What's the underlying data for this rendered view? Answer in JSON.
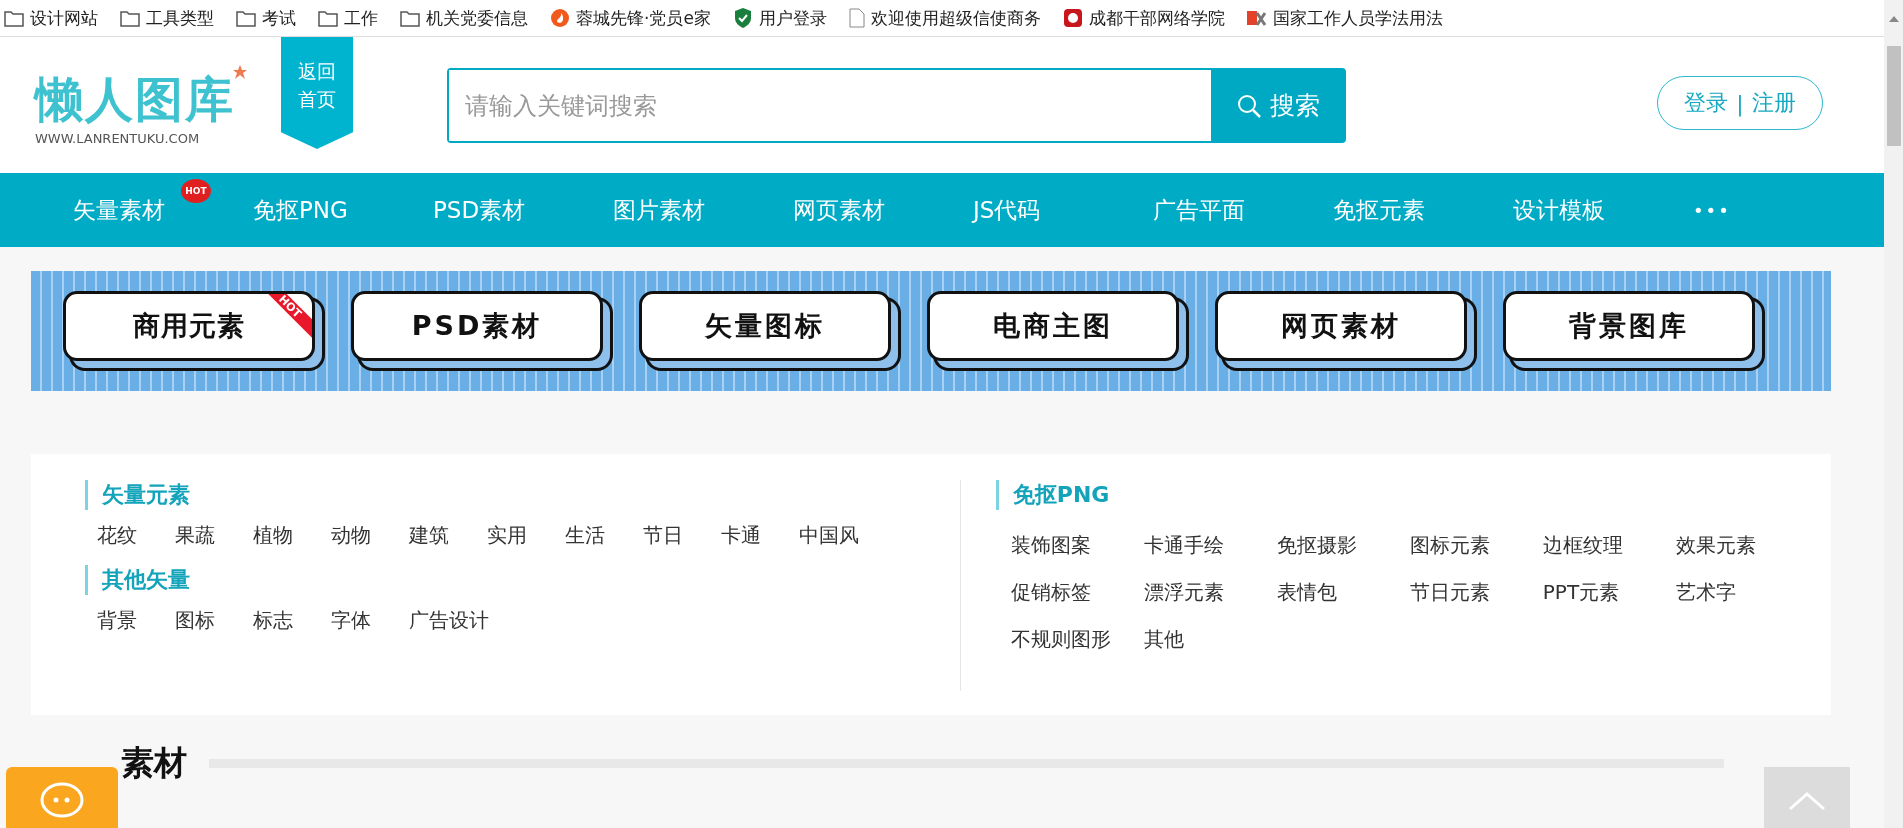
{
  "bookmarks": [
    {
      "label": "设计网站",
      "kind": "folder"
    },
    {
      "label": "工具类型",
      "kind": "folder"
    },
    {
      "label": "考试",
      "kind": "folder"
    },
    {
      "label": "工作",
      "kind": "folder"
    },
    {
      "label": "机关党委信息",
      "kind": "folder"
    },
    {
      "label": "蓉城先锋·党员e家",
      "kind": "flame"
    },
    {
      "label": "用户登录",
      "kind": "shield"
    },
    {
      "label": "欢迎使用超级信使商务",
      "kind": "page"
    },
    {
      "label": "成都干部网络学院",
      "kind": "badge"
    },
    {
      "label": "国家工作人员学法用法",
      "kind": "fx"
    }
  ],
  "header": {
    "logo": "懒人图库",
    "logo_url": "WWW.LANRENTUKU.COM",
    "home_ribbon": [
      "返回",
      "首页"
    ],
    "search": {
      "placeholder": "请输入关键词搜索",
      "button": "搜索"
    },
    "login": "登录",
    "register": "注册",
    "separator": "|"
  },
  "nav": {
    "items": [
      {
        "label": "矢量素材",
        "hot": true,
        "hot_label": "HOT"
      },
      {
        "label": "免抠PNG",
        "hot": false
      },
      {
        "label": "PSD素材",
        "hot": false
      },
      {
        "label": "图片素材",
        "hot": false
      },
      {
        "label": "网页素材",
        "hot": false
      },
      {
        "label": "JS代码",
        "hot": false
      },
      {
        "label": "广告平面",
        "hot": false
      },
      {
        "label": "免抠元素",
        "hot": false
      },
      {
        "label": "设计模板",
        "hot": false
      }
    ],
    "more": "•••"
  },
  "banner": [
    {
      "label": "商用元素",
      "hot": true,
      "hot_label": "HOT"
    },
    {
      "label": "PSD素材",
      "hot": false
    },
    {
      "label": "矢量图标",
      "hot": false
    },
    {
      "label": "电商主图",
      "hot": false
    },
    {
      "label": "网页素材",
      "hot": false
    },
    {
      "label": "背景图库",
      "hot": false
    }
  ],
  "categories": {
    "left": [
      {
        "title": "矢量元素",
        "tags": [
          "花纹",
          "果蔬",
          "植物",
          "动物",
          "建筑",
          "实用",
          "生活",
          "节日",
          "卡通",
          "中国风"
        ]
      },
      {
        "title": "其他矢量",
        "tags": [
          "背景",
          "图标",
          "标志",
          "字体",
          "广告设计"
        ]
      }
    ],
    "right": [
      {
        "title": "免抠PNG",
        "tags": [
          "装饰图案",
          "卡通手绘",
          "免抠摄影",
          "图标元素",
          "边框纹理",
          "效果元素",
          "促销标签",
          "漂浮元素",
          "表情包",
          "节日元素",
          "PPT元素",
          "艺术字",
          "不规则图形",
          "其他"
        ]
      }
    ]
  },
  "section": {
    "title": "素材"
  }
}
